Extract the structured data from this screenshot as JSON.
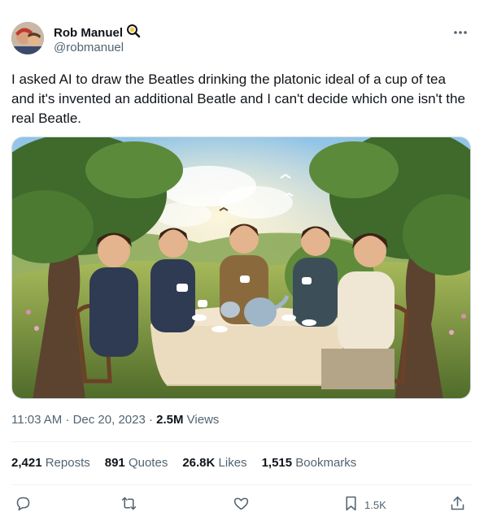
{
  "author": {
    "display_name": "Rob Manuel",
    "handle": "@robmanuel",
    "badge_icon": "magnifier-emoji-icon"
  },
  "tweet": {
    "text": "I asked AI to draw the Beatles drinking the platonic ideal of a cup of tea and it's invented an additional Beatle and I can't decide which one isn't the real Beatle."
  },
  "media": {
    "description_icon": "ai-generated-image"
  },
  "meta": {
    "timestamp": "11:03 AM · Dec 20, 2023 · ",
    "views_count": "2.5M",
    "views_label": " Views"
  },
  "stats": {
    "reposts_count": "2,421",
    "reposts_label": "Reposts",
    "quotes_count": "891",
    "quotes_label": "Quotes",
    "likes_count": "26.8K",
    "likes_label": "Likes",
    "bookmarks_count": "1,515",
    "bookmarks_label": "Bookmarks"
  },
  "actions": {
    "bookmark_count": "1.5K"
  },
  "colors": {
    "text_primary": "#0f1419",
    "text_secondary": "#536471",
    "divider": "#eff3f4"
  }
}
